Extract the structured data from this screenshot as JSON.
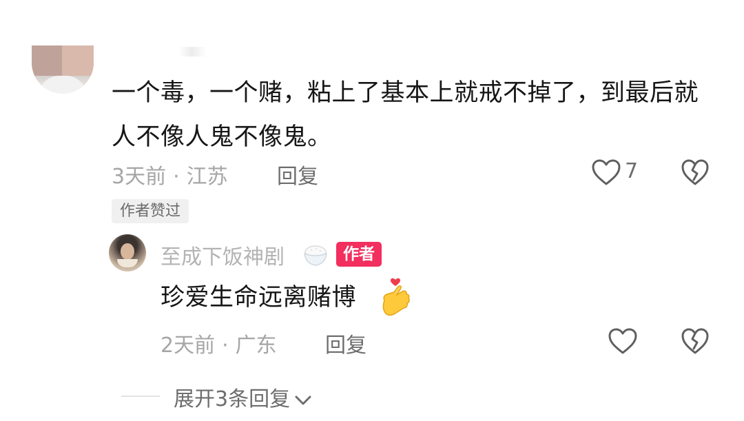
{
  "comment": {
    "text": "一个毒，一个赌，粘上了基本上就戒不掉了，到最后就人不像人鬼不像鬼。",
    "time": "3天前",
    "separator": "·",
    "location": "江苏",
    "reply_label": "回复",
    "like_count": "7",
    "author_liked_badge": "作者赞过"
  },
  "reply": {
    "username": "至成下饭神剧",
    "author_badge": "作者",
    "text": "珍爱生命远离赌博",
    "time": "2天前",
    "separator": "·",
    "location": "广东",
    "reply_label": "回复"
  },
  "expand": {
    "label": "展开3条回复"
  },
  "colors": {
    "text_primary": "#161616",
    "text_meta": "#a6a6a6",
    "author_badge_bg": "#f22f5e",
    "liked_badge_bg": "#f0f0f0"
  },
  "icons": {
    "like": "heart-outline-icon",
    "dislike": "broken-heart-icon",
    "user_decoration": "rice-bowl-icon",
    "emoji": "finger-heart-emoji",
    "expand": "chevron-down-icon"
  }
}
